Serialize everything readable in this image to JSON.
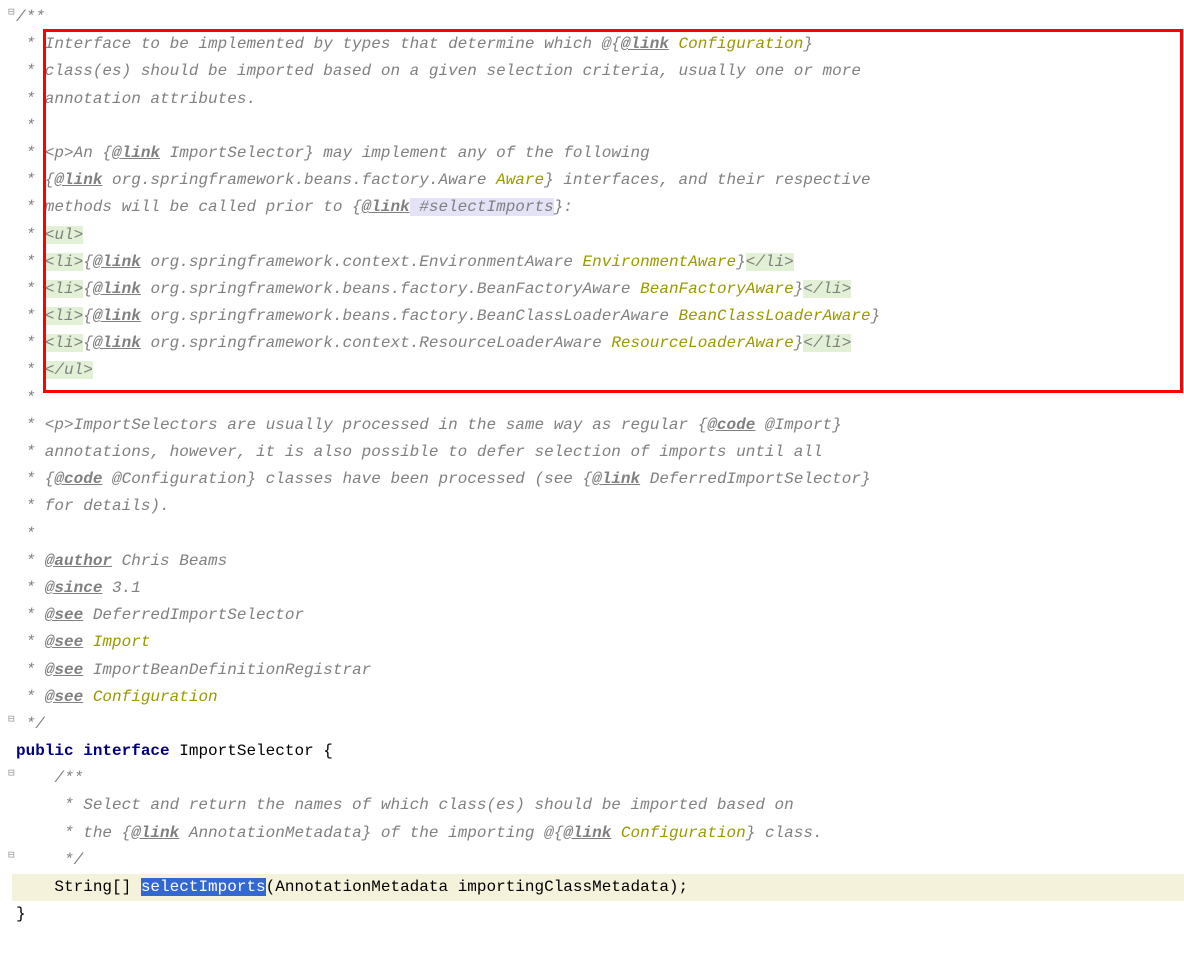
{
  "lines": {
    "l0": "/**",
    "l1_prefix": " * Interface to be implemented by types that determine which @{",
    "l1_tag": "@link",
    "l1_link": " Configuration",
    "l1_suffix": "}",
    "l2": " * class(es) should be imported based on a given selection criteria, usually one or more",
    "l3": " * annotation attributes.",
    "l4": " *",
    "l5_prefix": " * ",
    "l5_ptag": "<p>",
    "l5_text1": "An {",
    "l5_tag": "@link",
    "l5_class": " ImportSelector",
    "l5_text2": "} may implement any of the following",
    "l6_prefix": " * {",
    "l6_tag": "@link",
    "l6_pkg": " org.springframework.beans.factory.Aware",
    "l6_name": " Aware",
    "l6_suffix": "} interfaces, and their respective",
    "l7_prefix": " * methods will be called prior to {",
    "l7_tag": "@link",
    "l7_method": " #selectImports",
    "l7_suffix": "}:",
    "l8_prefix": " * ",
    "l8_ul": "<ul>",
    "l9_prefix": " * ",
    "l9_li": "<li>",
    "l9_text1": "{",
    "l9_tag": "@link",
    "l9_pkg": " org.springframework.context.EnvironmentAware",
    "l9_name": " EnvironmentAware",
    "l9_text2": "}",
    "l9_li_close": "</li>",
    "l10_prefix": " * ",
    "l10_li": "<li>",
    "l10_text1": "{",
    "l10_tag": "@link",
    "l10_pkg": " org.springframework.beans.factory.BeanFactoryAware",
    "l10_name": " BeanFactoryAware",
    "l10_text2": "}",
    "l10_li_close": "</li>",
    "l11_prefix": " * ",
    "l11_li": "<li>",
    "l11_text1": "{",
    "l11_tag": "@link",
    "l11_pkg": " org.springframework.beans.factory.BeanClassLoaderAware",
    "l11_name": " BeanClassLoaderAware",
    "l11_text2": "}",
    "l12_prefix": " * ",
    "l12_li": "<li>",
    "l12_text1": "{",
    "l12_tag": "@link",
    "l12_pkg": " org.springframework.context.ResourceLoaderAware",
    "l12_name": " ResourceLoaderAware",
    "l12_text2": "}",
    "l12_li_close": "</li>",
    "l13_prefix": " * ",
    "l13_ul": "</ul>",
    "l14": " *",
    "l15_prefix": " * ",
    "l15_ptag": "<p>",
    "l15_text1": "ImportSelectors are usually processed in the same way as regular {",
    "l15_tag": "@code",
    "l15_code": " @Import",
    "l15_text2": "}",
    "l16": " * annotations, however, it is also possible to defer selection of imports until all",
    "l17_prefix": " * {",
    "l17_tag": "@code",
    "l17_code": " @Configuration",
    "l17_text1": "} classes have been processed (see {",
    "l17_tag2": "@link",
    "l17_class": " DeferredImportSelector",
    "l17_suffix": "}",
    "l18": " * for details).",
    "l19": " *",
    "l20_prefix": " * ",
    "l20_tag": "@author",
    "l20_val": " Chris Beams",
    "l21_prefix": " * ",
    "l21_tag": "@since",
    "l21_val": " 3.1",
    "l22_prefix": " * ",
    "l22_tag": "@see",
    "l22_val": " DeferredImportSelector",
    "l23_prefix": " * ",
    "l23_tag": "@see",
    "l23_val": " Import",
    "l24_prefix": " * ",
    "l24_tag": "@see",
    "l24_val": " ImportBeanDefinitionRegistrar",
    "l25_prefix": " * ",
    "l25_tag": "@see",
    "l25_val": " Configuration",
    "l26": " */",
    "l27_kw1": "public",
    "l27_kw2": "interface",
    "l27_name": "ImportSelector {",
    "l28": "",
    "l29": "    /**",
    "l30": "     * Select and return the names of which class(es) should be imported based on",
    "l31_prefix": "     * the {",
    "l31_tag": "@link",
    "l31_class": " AnnotationMetadata",
    "l31_text1": "} of the importing @{",
    "l31_tag2": "@link",
    "l31_class2": " Configuration",
    "l31_suffix": "} class.",
    "l32": "     */",
    "l33_prefix": "    String[] ",
    "l33_method": "selectImports",
    "l33_params": "(AnnotationMetadata importingClassMetadata);",
    "l34": "",
    "l35": "}"
  }
}
